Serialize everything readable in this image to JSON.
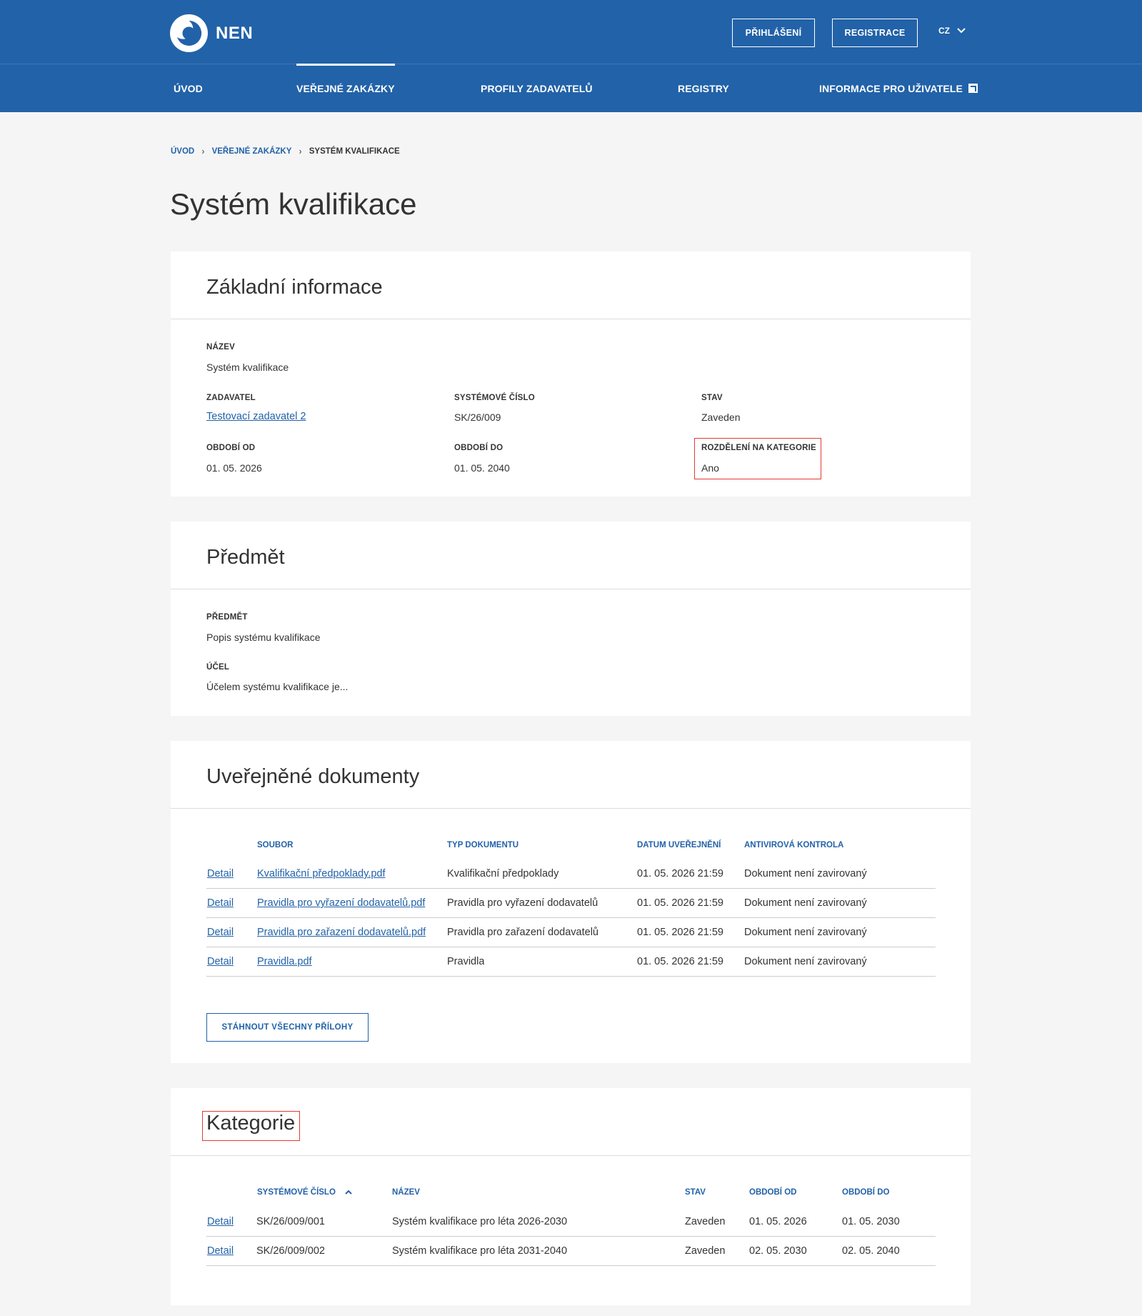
{
  "header": {
    "logo_text": "NEN",
    "login_label": "PŘIHLÁŠENÍ",
    "register_label": "REGISTRACE",
    "lang": "CZ"
  },
  "nav": {
    "items": [
      "ÚVOD",
      "VEŘEJNÉ ZAKÁZKY",
      "PROFILY ZADAVATELŮ",
      "REGISTRY",
      "INFORMACE PRO UŽIVATELE"
    ],
    "active": "VEŘEJNÉ ZAKÁZKY"
  },
  "breadcrumb": [
    "ÚVOD",
    "VEŘEJNÉ ZAKÁZKY",
    "SYSTÉM KVALIFIKACE"
  ],
  "page_title": "Systém kvalifikace",
  "basic_info": {
    "title": "Základní informace",
    "name_label": "NÁZEV",
    "name_value": "Systém kvalifikace",
    "contracting_label": "ZADAVATEL",
    "contracting_value": "Testovací zadavatel 2",
    "sysnum_label": "SYSTÉMOVÉ ČÍSLO",
    "sysnum_value": "SK/26/009",
    "status_label": "STAV",
    "status_value": "Zaveden",
    "from_label": "OBDOBÍ OD",
    "from_value": "01. 05. 2026",
    "to_label": "OBDOBÍ DO",
    "to_value": "01. 05. 2040",
    "categories_label": "ROZDĚLENÍ NA KATEGORIE",
    "categories_value": "Ano"
  },
  "subject": {
    "title": "Předmět",
    "subject_label": "PŘEDMĚT",
    "subject_value": "Popis systému kvalifikace",
    "purpose_label": "ÚČEL",
    "purpose_value": "Účelem systému kvalifikace je..."
  },
  "documents": {
    "title": "Uveřejněné dokumenty",
    "columns": [
      "SOUBOR",
      "TYP DOKUMENTU",
      "DATUM UVEŘEJNĚNÍ",
      "ANTIVIROVÁ KONTROLA"
    ],
    "rows": [
      {
        "detail": "Detail",
        "file": "Kvalifikační předpoklady.pdf",
        "type": "Kvalifikační předpoklady",
        "date": "01. 05. 2026 21:59",
        "av": "Dokument není zavirovaný"
      },
      {
        "detail": "Detail",
        "file": "Pravidla pro vyřazení dodavatelů.pdf",
        "type": "Pravidla pro vyřazení dodavatelů",
        "date": "01. 05. 2026 21:59",
        "av": "Dokument není zavirovaný"
      },
      {
        "detail": "Detail",
        "file": "Pravidla pro zařazení dodavatelů.pdf",
        "type": "Pravidla pro zařazení dodavatelů",
        "date": "01. 05. 2026 21:59",
        "av": "Dokument není zavirovaný"
      },
      {
        "detail": "Detail",
        "file": "Pravidla.pdf",
        "type": "Pravidla",
        "date": "01. 05. 2026 21:59",
        "av": "Dokument není zavirovaný"
      }
    ],
    "download_all_label": "STÁHNOUT VŠECHNY PŘÍLOHY"
  },
  "categories": {
    "title": "Kategorie",
    "columns": [
      "SYSTÉMOVÉ ČÍSLO",
      "NÁZEV",
      "STAV",
      "OBDOBÍ OD",
      "OBDOBÍ DO"
    ],
    "rows": [
      {
        "detail": "Detail",
        "sysnum": "SK/26/009/001",
        "name": "Systém kvalifikace pro léta 2026-2030",
        "status": "Zaveden",
        "from": "01. 05. 2026",
        "to": "01. 05. 2030"
      },
      {
        "detail": "Detail",
        "sysnum": "SK/26/009/002",
        "name": "Systém kvalifikace pro léta 2031-2040",
        "status": "Zaveden",
        "from": "02. 05. 2030",
        "to": "02. 05. 2040"
      }
    ]
  },
  "colors": {
    "brand": "#2262a8",
    "highlight": "#e53935"
  }
}
